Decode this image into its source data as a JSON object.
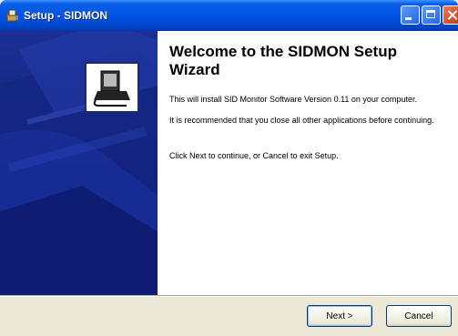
{
  "window": {
    "title": "Setup - SIDMON"
  },
  "main": {
    "heading": "Welcome to the SIDMON Setup Wizard",
    "paragraphs": [
      "This will install SID Monitor Software Version 0.11 on your computer.",
      "It is recommended that you close all other applications before continuing.",
      "Click Next to continue, or Cancel to exit Setup."
    ]
  },
  "buttons": {
    "next_label": "Next >",
    "cancel_label": "Cancel"
  },
  "icons": {
    "app": "setup-installer-icon",
    "logo": "computer-disk-icon"
  },
  "colors": {
    "titlebar": "#0054e3",
    "side_panel": "#0d1f7a"
  }
}
